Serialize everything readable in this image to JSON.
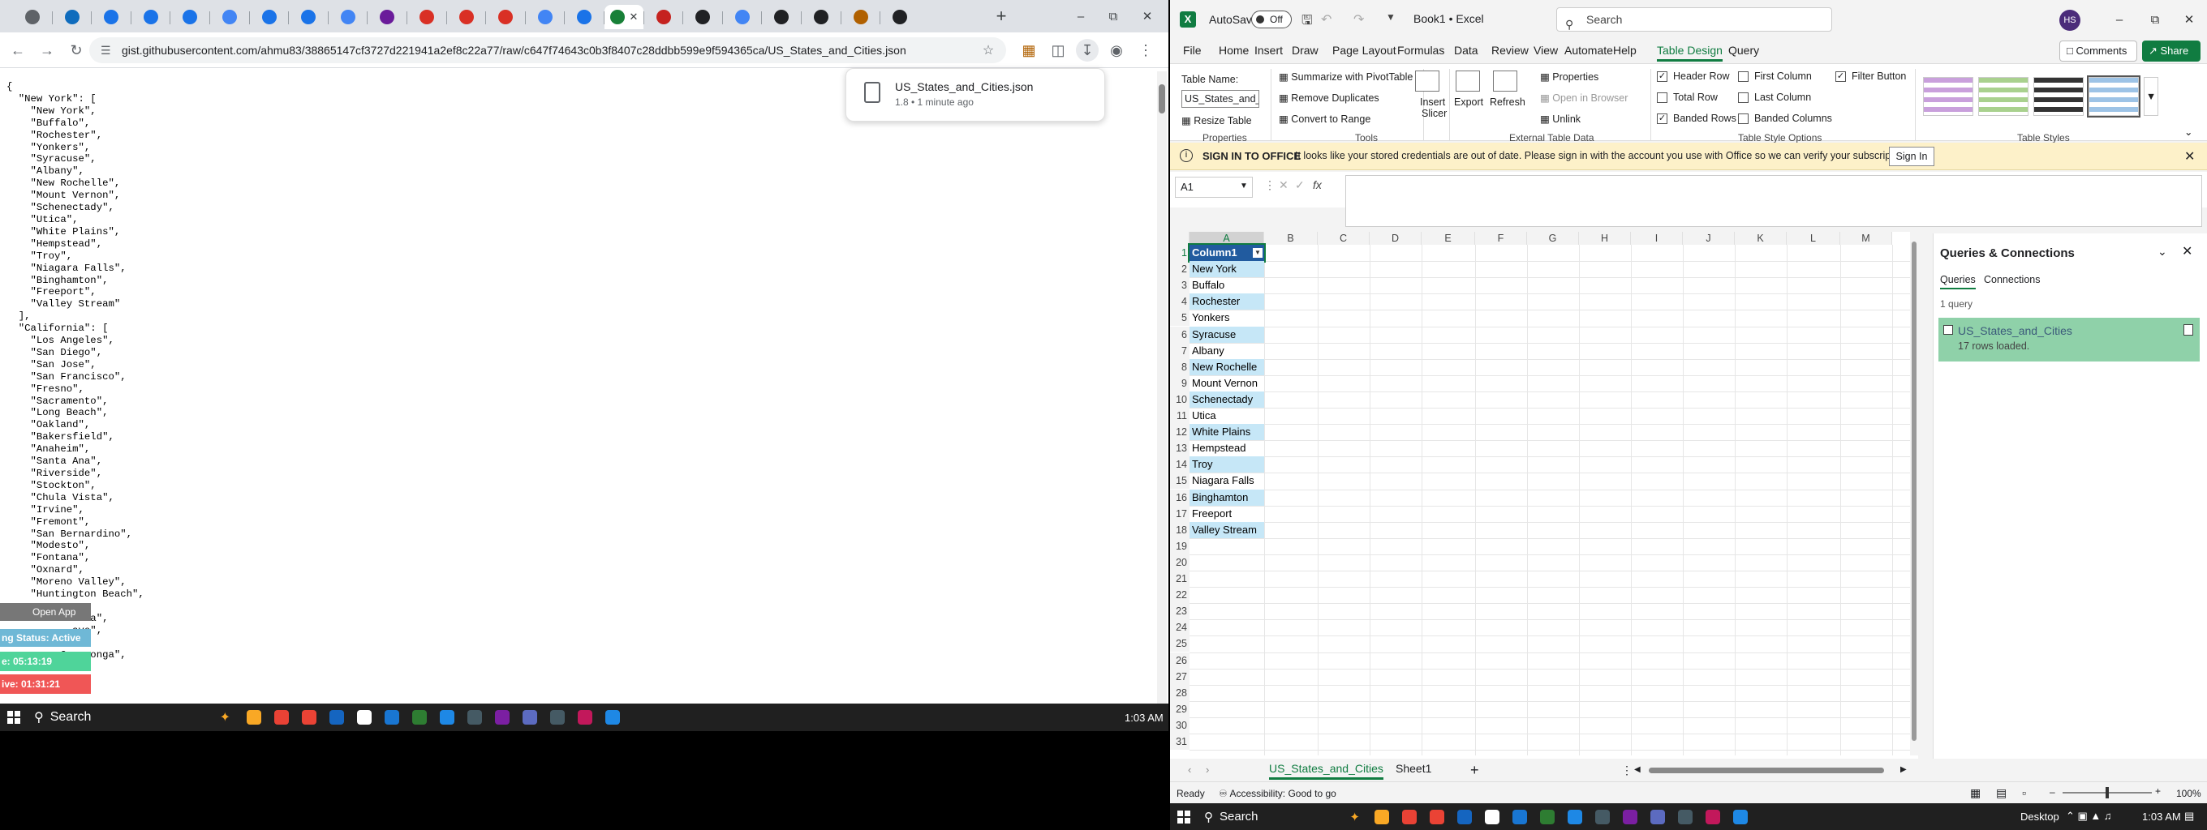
{
  "chrome": {
    "tabs": [
      {
        "icon": "chrome-icon",
        "color": "#5f6368"
      },
      {
        "icon": "outlook-icon",
        "color": "#0f6cbd"
      },
      {
        "icon": "blue-app-icon",
        "color": "#1a73e8"
      },
      {
        "icon": "blue-app-icon",
        "color": "#1a73e8"
      },
      {
        "icon": "blue-app-icon",
        "color": "#1a73e8"
      },
      {
        "icon": "google-icon",
        "color": "#4285f4"
      },
      {
        "icon": "blue-app-icon",
        "color": "#1a73e8"
      },
      {
        "icon": "blue-app-icon",
        "color": "#1a73e8"
      },
      {
        "icon": "google-icon",
        "color": "#4285f4"
      },
      {
        "icon": "mail-icon",
        "color": "#6a1b9a"
      },
      {
        "icon": "red-app-icon",
        "color": "#d93025"
      },
      {
        "icon": "red-app-icon",
        "color": "#d93025"
      },
      {
        "icon": "red-app-icon",
        "color": "#d93025"
      },
      {
        "icon": "google-icon",
        "color": "#4285f4"
      },
      {
        "icon": "blue-app-icon",
        "color": "#1a73e8"
      },
      {
        "icon": "green-app-icon",
        "color": "#188038"
      },
      {
        "icon": "red-app-icon",
        "color": "#c5221f"
      },
      {
        "icon": "github-icon",
        "color": "#202124"
      },
      {
        "icon": "puzzle-icon",
        "color": "#4285f4"
      },
      {
        "icon": "github-icon",
        "color": "#202124"
      },
      {
        "icon": "github-icon",
        "color": "#202124"
      },
      {
        "icon": "shield-icon",
        "color": "#b06000"
      },
      {
        "icon": "github-icon",
        "color": "#202124"
      }
    ],
    "url": "gist.githubusercontent.com/ahmu83/38865147cf3727d221941a2ef8c22a77/raw/c647f74643c0b3f8407c28ddbb599e9f594365ca/US_States_and_Cities.json",
    "download": {
      "filename": "US_States_and_Cities.json",
      "meta": "1.8 • 1 minute ago"
    },
    "json_lines": [
      "{",
      "  \"New York\": [",
      "    \"New York\",",
      "    \"Buffalo\",",
      "    \"Rochester\",",
      "    \"Yonkers\",",
      "    \"Syracuse\",",
      "    \"Albany\",",
      "    \"New Rochelle\",",
      "    \"Mount Vernon\",",
      "    \"Schenectady\",",
      "    \"Utica\",",
      "    \"White Plains\",",
      "    \"Hempstead\",",
      "    \"Troy\",",
      "    \"Niagara Falls\",",
      "    \"Binghamton\",",
      "    \"Freeport\",",
      "    \"Valley Stream\"",
      "  ],",
      "  \"California\": [",
      "    \"Los Angeles\",",
      "    \"San Diego\",",
      "    \"San Jose\",",
      "    \"San Francisco\",",
      "    \"Fresno\",",
      "    \"Sacramento\",",
      "    \"Long Beach\",",
      "    \"Oakland\",",
      "    \"Bakersfield\",",
      "    \"Anaheim\",",
      "    \"Santa Ana\",",
      "    \"Riverside\",",
      "    \"Stockton\",",
      "    \"Chula Vista\",",
      "    \"Irvine\",",
      "    \"Fremont\",",
      "    \"San Bernardino\",",
      "    \"Modesto\",",
      "    \"Fontana\",",
      "    \"Oxnard\",",
      "    \"Moreno Valley\",",
      "    \"Huntington Beach\",",
      "",
      "           rita\",",
      "           ave\",",
      "",
      "         Cucamonga\",",
      "",
      "",
      "",
      ","
    ]
  },
  "widget": {
    "open_app": "Open App",
    "status": "ng Status: Active",
    "time1": "e: 05:13:19",
    "time2": "ive: 01:31:21"
  },
  "taskbar_left": {
    "search": "Search",
    "time": "1:03 AM",
    "apps": [
      "#f9a825",
      "#e94235",
      "#ea4335",
      "#1565c0",
      "#fff",
      "#1976d2",
      "#2e7d32",
      "#1e88e5",
      "#455a64",
      "#7b1fa2",
      "#5c6bc0",
      "#455a64",
      "#c2185b",
      "#1e88e5"
    ]
  },
  "excel": {
    "autosave": "AutoSave",
    "autosave_state": "Off",
    "doc_title": "Book1 • Excel",
    "search": "Search",
    "avatar": "HS",
    "menu": [
      "File",
      "Home",
      "Insert",
      "Draw",
      "Page Layout",
      "Formulas",
      "Data",
      "Review",
      "View",
      "Automate",
      "Help",
      "Table Design",
      "Query"
    ],
    "active_menu": "Table Design",
    "comments": "Comments",
    "share": "Share",
    "ribbon": {
      "table_name_label": "Table Name:",
      "table_name_value": "US_States_and_Ci",
      "resize_table": "Resize Table",
      "properties_group": "Properties",
      "summarize": "Summarize with PivotTable",
      "remove_dup": "Remove Duplicates",
      "convert": "Convert to Range",
      "tools_group": "Tools",
      "insert_slicer_1": "Insert",
      "insert_slicer_2": "Slicer",
      "export": "Export",
      "refresh": "Refresh",
      "ext_properties": "Properties",
      "open_browser": "Open in Browser",
      "unlink": "Unlink",
      "ext_group": "External Table Data",
      "header_row": "Header Row",
      "total_row": "Total Row",
      "banded_rows": "Banded Rows",
      "first_col": "First Column",
      "last_col": "Last Column",
      "banded_cols": "Banded Columns",
      "filter_btn": "Filter Button",
      "opts_group": "Table Style Options",
      "styles_group": "Table Styles"
    },
    "info": {
      "title": "SIGN IN TO OFFICE",
      "message": "It looks like your stored credentials are out of date. Please sign in with the account you use with Office so we can verify your subscription.",
      "button": "Sign In"
    },
    "namebox": "A1",
    "columns": [
      "A",
      "B",
      "C",
      "D",
      "E",
      "F",
      "G",
      "H",
      "I",
      "J",
      "K",
      "L",
      "M"
    ],
    "rows": [
      "1",
      "2",
      "3",
      "4",
      "5",
      "6",
      "7",
      "8",
      "9",
      "10",
      "11",
      "12",
      "13",
      "14",
      "15",
      "16",
      "17",
      "18",
      "19",
      "20",
      "21",
      "22",
      "23",
      "24",
      "25",
      "26",
      "27",
      "28",
      "29",
      "30",
      "31"
    ],
    "table_header": "Column1",
    "cells": [
      "New York",
      "Buffalo",
      "Rochester",
      "Yonkers",
      "Syracuse",
      "Albany",
      "New Rochelle",
      "Mount Vernon",
      "Schenectady",
      "Utica",
      "White Plains",
      "Hempstead",
      "Troy",
      "Niagara Falls",
      "Binghamton",
      "Freeport",
      "Valley Stream"
    ],
    "sheets": [
      "US_States_and_Cities",
      "Sheet1"
    ],
    "status_ready": "Ready",
    "accessibility": "Accessibility: Good to go",
    "view_mode": "Desktop",
    "zoom": "100%",
    "queries": {
      "title": "Queries & Connections",
      "tab_queries": "Queries",
      "tab_connections": "Connections",
      "count": "1 query",
      "item_name": "US_States_and_Cities",
      "item_meta": "17 rows loaded."
    }
  },
  "taskbar_right": {
    "search": "Search",
    "desktop": "Desktop",
    "time": "1:03 AM"
  }
}
